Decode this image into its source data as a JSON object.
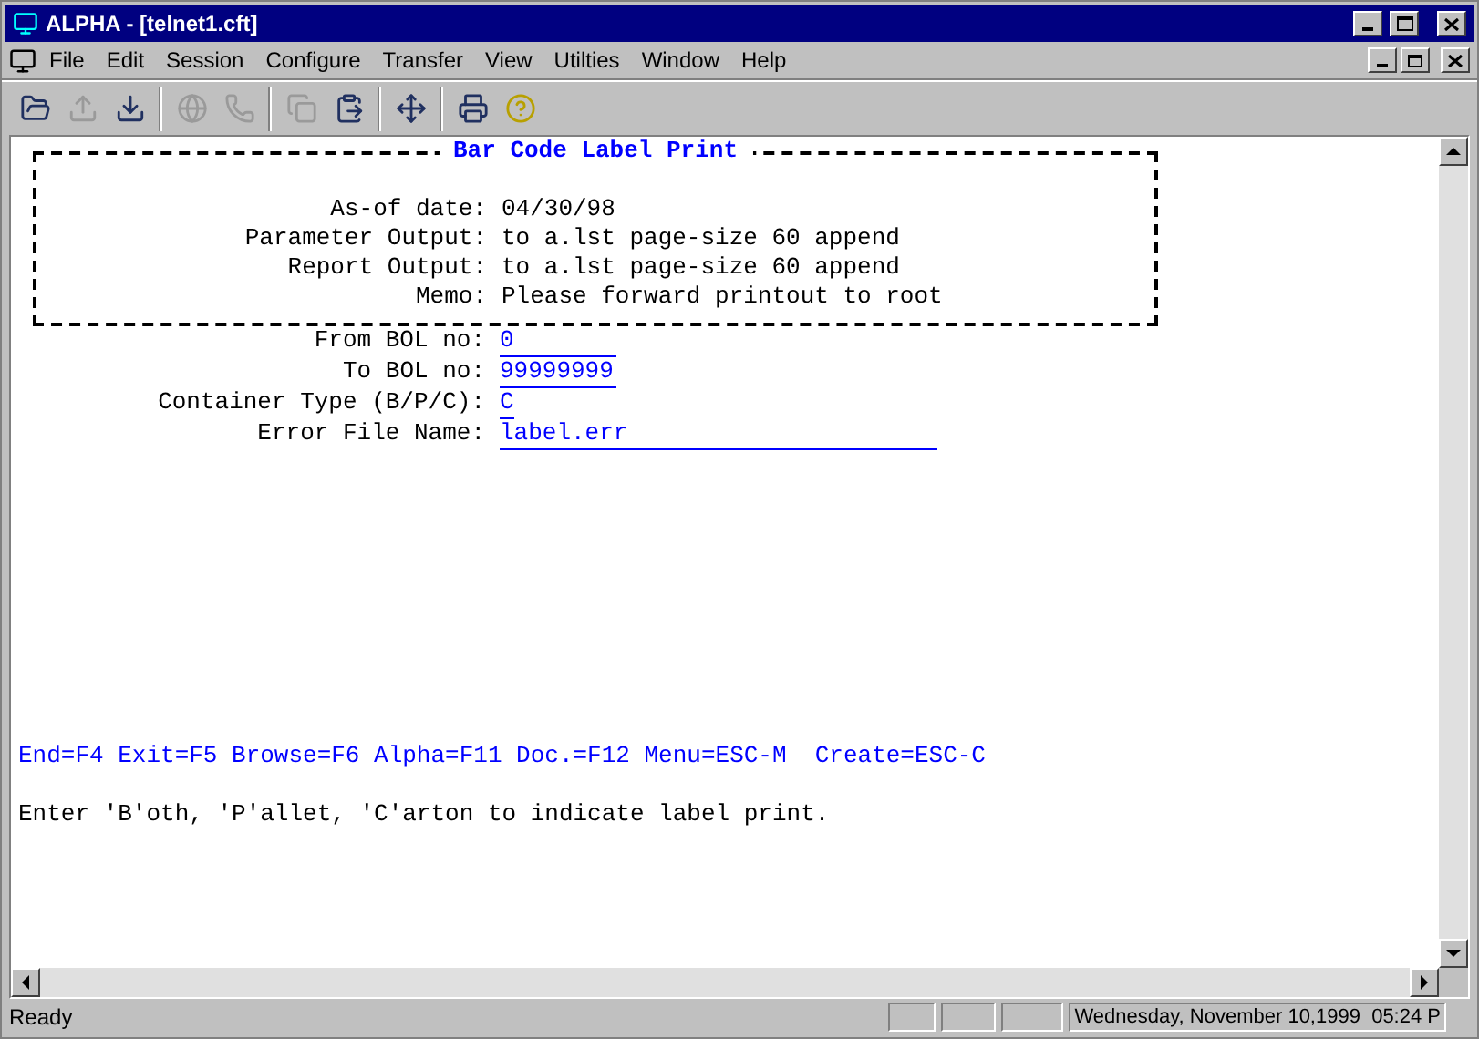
{
  "window": {
    "title": "ALPHA - [telnet1.cft]"
  },
  "menu": [
    "File",
    "Edit",
    "Session",
    "Configure",
    "Transfer",
    "View",
    "Utilties",
    "Window",
    "Help"
  ],
  "toolbar": [
    {
      "kind": "open",
      "disabled": false
    },
    {
      "kind": "upload",
      "disabled": true
    },
    {
      "kind": "download",
      "disabled": false
    },
    {
      "kind": "connect",
      "disabled": true
    },
    {
      "kind": "phone",
      "disabled": true
    },
    {
      "kind": "copy",
      "disabled": true
    },
    {
      "kind": "paste",
      "disabled": false
    },
    {
      "kind": "fit",
      "disabled": false
    },
    {
      "kind": "print",
      "disabled": false
    },
    {
      "kind": "help",
      "disabled": false
    }
  ],
  "terminal": {
    "box_title": "Bar Code Label Print",
    "header_rows": [
      {
        "label": "As-of date:",
        "value": "04/30/98"
      },
      {
        "label": "Parameter Output:",
        "value": "to a.lst page-size 60 append"
      },
      {
        "label": "Report Output:",
        "value": "to a.lst page-size 60 append"
      },
      {
        "label": "Memo:",
        "value": "Please forward printout to root"
      }
    ],
    "fields": [
      {
        "label": "From BOL no:",
        "value": "0",
        "kind": "short"
      },
      {
        "label": "To BOL no:",
        "value": "99999999",
        "kind": "short"
      },
      {
        "label": "Container Type (B/P/C):",
        "value": "C",
        "kind": "char"
      },
      {
        "label": "Error File Name:",
        "value": "label.err",
        "kind": "long"
      }
    ],
    "function_keys": "End=F4 Exit=F5 Browse=F6 Alpha=F11 Doc.=F12 Menu=ESC-M  Create=ESC-C",
    "message": "Enter 'B'oth, 'P'allet, 'C'arton to indicate label print."
  },
  "status_bar": {
    "text": "Ready",
    "datetime": "Wednesday, November 10,1999  05:24 P"
  }
}
